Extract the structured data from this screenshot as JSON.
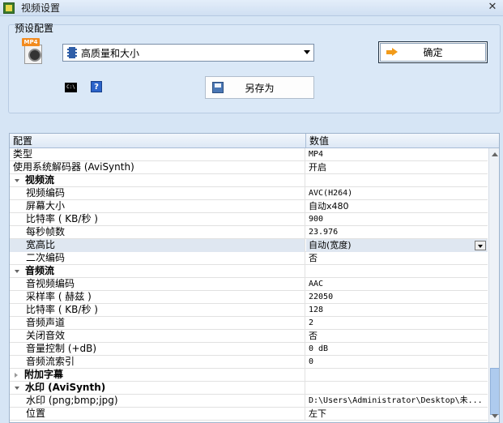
{
  "window": {
    "title": "视频设置",
    "close_glyph": "✕"
  },
  "preset": {
    "label": "预设配置",
    "mp4_icon_text": "MP4",
    "selected": "高质量和大小",
    "ok_label": "确定",
    "save_as_label": "另存为",
    "cmd_icon_text": "C:\\"
  },
  "grid": {
    "headers": {
      "name": "配置",
      "value": "数值"
    },
    "rows": [
      {
        "name": "类型",
        "value": "MP4"
      },
      {
        "name": "使用系统解码器 (AviSynth)",
        "value": "开启"
      },
      {
        "name": "视频流"
      },
      {
        "name": "视频编码",
        "value": "AVC(H264)"
      },
      {
        "name": "屏幕大小",
        "value": "自动x480"
      },
      {
        "name": "比特率 ( KB/秒 )",
        "value": "900"
      },
      {
        "name": "每秒帧数",
        "value": "23.976"
      },
      {
        "name": "宽高比",
        "value": "自动(宽度)"
      },
      {
        "name": "二次编码",
        "value": "否"
      },
      {
        "name": "音频流"
      },
      {
        "name": "音视频编码",
        "value": "AAC"
      },
      {
        "name": "采样率 ( 赫兹 )",
        "value": "22050"
      },
      {
        "name": "比特率 ( KB/秒 )",
        "value": "128"
      },
      {
        "name": "音频声道",
        "value": "2"
      },
      {
        "name": "关闭音效",
        "value": "否"
      },
      {
        "name": "音量控制 (+dB)",
        "value": "0 dB"
      },
      {
        "name": "音频流索引",
        "value": "0"
      },
      {
        "name": "附加字幕"
      },
      {
        "name": "水印 (AviSynth)"
      },
      {
        "name": "水印 (png;bmp;jpg)",
        "value": "D:\\Users\\Administrator\\Desktop\\未..."
      },
      {
        "name": "位置",
        "value": "左下"
      }
    ]
  }
}
